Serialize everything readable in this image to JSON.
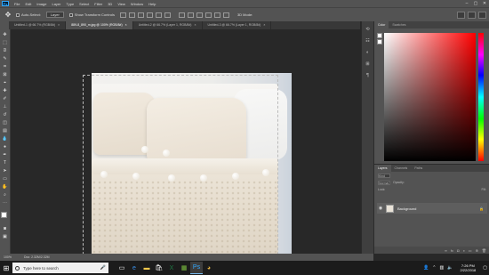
{
  "menubar": {
    "app_logo": "Ps",
    "items": [
      "File",
      "Edit",
      "Image",
      "Layer",
      "Type",
      "Select",
      "Filter",
      "3D",
      "View",
      "Window",
      "Help"
    ],
    "window_controls": [
      "–",
      "▢",
      "✕"
    ]
  },
  "options": {
    "auto_select_label": "Auto-Select:",
    "auto_select_value": "Layer",
    "show_transform_label": "Show Transform Controls",
    "mode_label": "3D Mode:"
  },
  "tabs": [
    {
      "label": "Untitled-1 @ 66.7% (RGB/8#)",
      "active": false
    },
    {
      "label": "889-8_890_m.jpg @ 100% (RGB/8#)",
      "active": true
    },
    {
      "label": "Untitled-2 @ 66.7% (Layer 1, RGB/8#)",
      "active": false
    },
    {
      "label": "Untitled-3 @ 66.7% (Layer 1, RGB/8#)",
      "active": false
    }
  ],
  "panels": {
    "color_tabs": [
      "Color",
      "Swatches"
    ],
    "layers_tabs": [
      "Layers",
      "Channels",
      "Paths"
    ],
    "layers_kind": "Kind",
    "layers_mode": "Normal",
    "layers_opacity": "Opacity:",
    "layers_lock": "Lock:",
    "layers_fill": "Fill:",
    "layer_name": "Background",
    "foreground_color": "#ffffff",
    "background_color": "#ffffff",
    "picker_hue": "#ff0000"
  },
  "status": {
    "zoom": "100%",
    "doc": "Doc: 2.32M/2.32M"
  },
  "taskbar": {
    "search_placeholder": "Type here to search",
    "time": "7:26 PM",
    "date": "2/22/2018"
  },
  "icons": {
    "start": "windows-logo",
    "move_tool": "move-icon",
    "tray": [
      "people-icon",
      "chevron-up-icon",
      "network-icon",
      "volume-icon",
      "notification-icon"
    ]
  }
}
